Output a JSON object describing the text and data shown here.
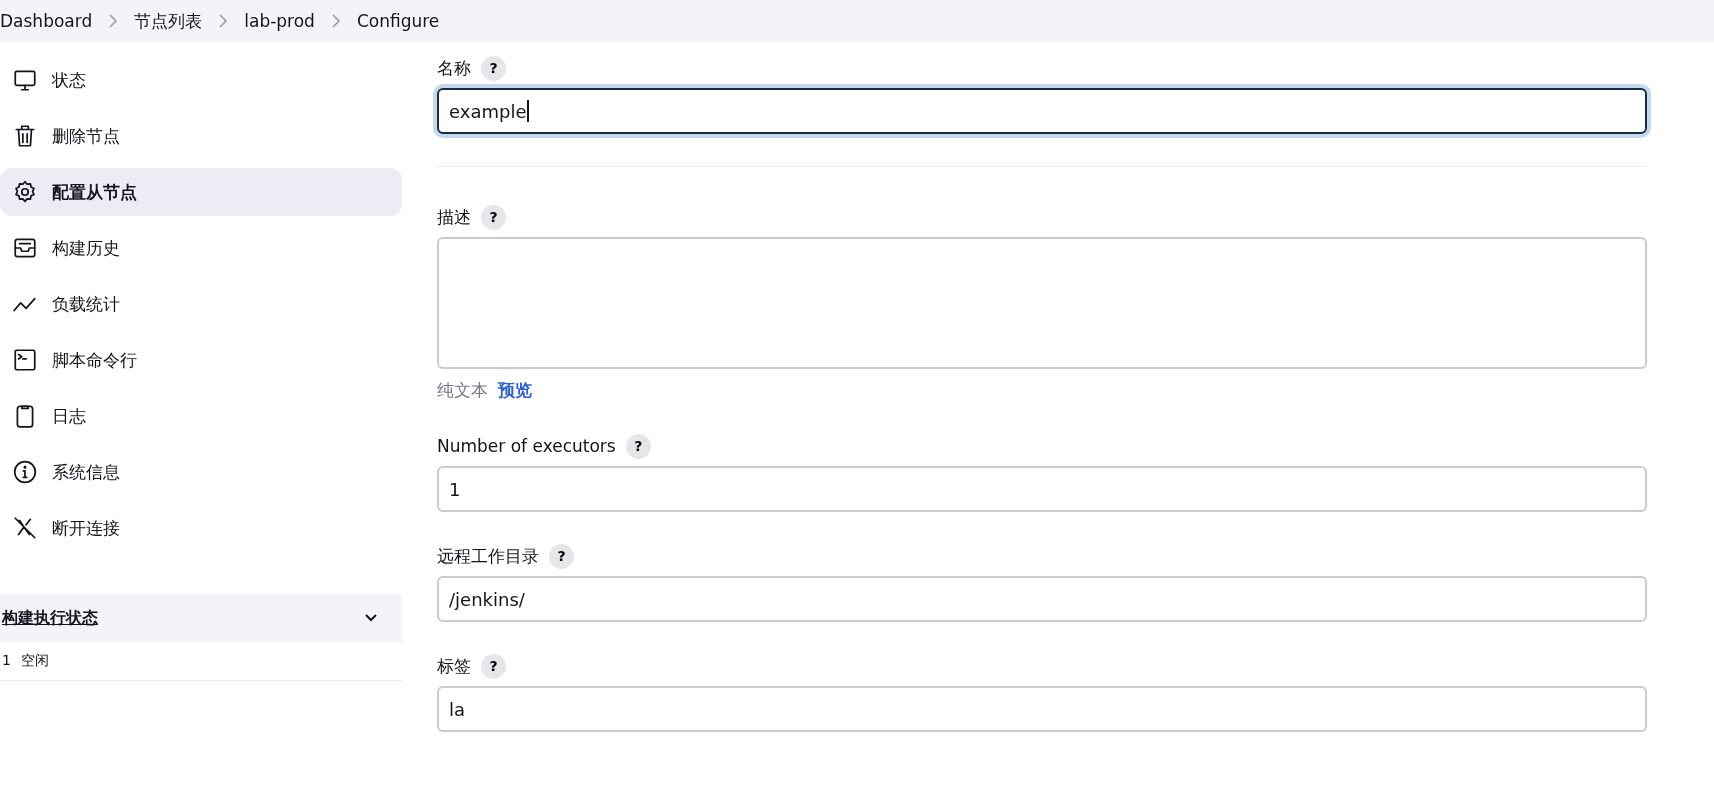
{
  "breadcrumbs": [
    "Dashboard",
    "节点列表",
    "lab-prod",
    "Configure"
  ],
  "sidebar": {
    "items": [
      {
        "label": "状态",
        "selected": false
      },
      {
        "label": "删除节点",
        "selected": false
      },
      {
        "label": "配置从节点",
        "selected": true
      },
      {
        "label": "构建历史",
        "selected": false
      },
      {
        "label": "负载统计",
        "selected": false
      },
      {
        "label": "脚本命令行",
        "selected": false
      },
      {
        "label": "日志",
        "selected": false
      },
      {
        "label": "系统信息",
        "selected": false
      },
      {
        "label": "断开连接",
        "selected": false
      }
    ],
    "executor_panel": {
      "title": "构建执行状态",
      "expanded": true,
      "rows": [
        {
          "number": "1",
          "status": "空闲"
        }
      ]
    }
  },
  "form": {
    "fields": [
      {
        "kind": "input",
        "label": "名称",
        "help": "?",
        "value": "example",
        "focused": true
      },
      {
        "kind": "textarea",
        "label": "描述",
        "help": "?",
        "format_links": [
          {
            "label": "纯文本",
            "selected": false
          },
          {
            "label": "预览",
            "selected": true
          }
        ]
      },
      {
        "kind": "input",
        "label": "Number of executors",
        "help": "?",
        "value": "1",
        "focused": false
      },
      {
        "kind": "input",
        "label": "远程工作目录",
        "help": "?",
        "value": "/jenkins/",
        "focused": false
      },
      {
        "kind": "input",
        "label": "标签",
        "help": "?",
        "value": "la",
        "focused": false
      }
    ]
  }
}
